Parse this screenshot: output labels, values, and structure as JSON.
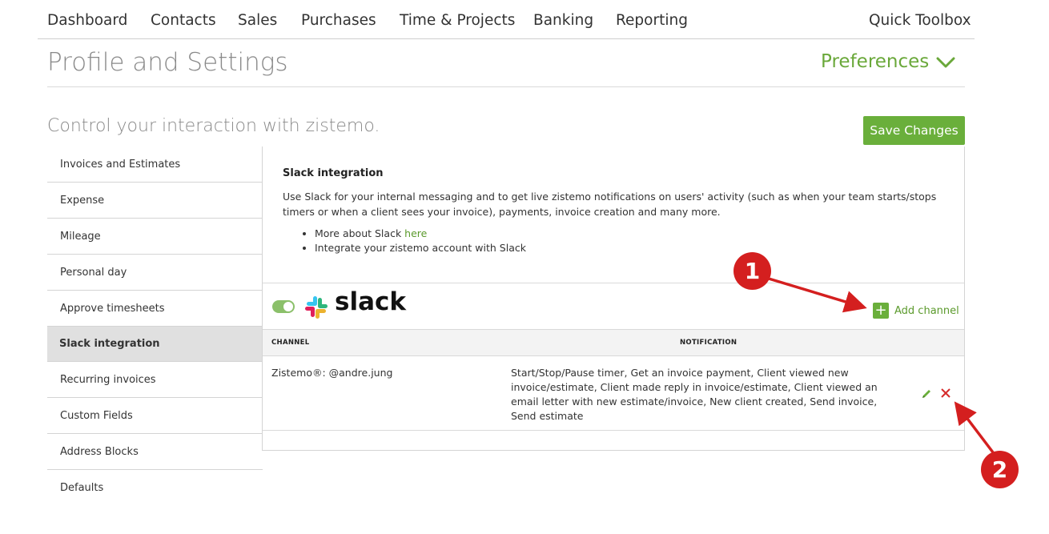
{
  "nav": {
    "items": [
      "Dashboard",
      "Contacts",
      "Sales",
      "Purchases",
      "Time & Projects",
      "Banking",
      "Reporting"
    ],
    "quick_toolbox": "Quick Toolbox"
  },
  "header": {
    "title": "Profile and Settings",
    "preferences": "Preferences",
    "preferences_icon": "chevron-down-icon"
  },
  "subheader": {
    "text": "Control your interaction with zistemo.",
    "save_label": "Save Changes"
  },
  "sidebar": {
    "items": [
      {
        "label": "Invoices and Estimates",
        "active": false
      },
      {
        "label": "Expense",
        "active": false
      },
      {
        "label": "Mileage",
        "active": false
      },
      {
        "label": "Personal day",
        "active": false
      },
      {
        "label": "Approve timesheets",
        "active": false
      },
      {
        "label": "Slack integration",
        "active": true
      },
      {
        "label": "Recurring invoices",
        "active": false
      },
      {
        "label": "Custom Fields",
        "active": false
      },
      {
        "label": "Address Blocks",
        "active": false
      },
      {
        "label": "Defaults",
        "active": false
      }
    ]
  },
  "slack": {
    "section_title": "Slack integration",
    "description": "Use Slack for your internal messaging and to get live zistemo notifications on users' activity (such as when your team starts/stops timers or when a client sees your invoice), payments, invoice creation and many more.",
    "bullet_1_prefix": "More about Slack ",
    "bullet_1_link": "here",
    "bullet_2": "Integrate your zistemo account with Slack",
    "toggle_on": true,
    "logo_text": "slack",
    "add_channel_label": "Add channel",
    "table": {
      "headers": {
        "channel": "CHANNEL",
        "notification": "NOTIFICATION"
      },
      "rows": [
        {
          "channel": "Zistemo®: @andre.jung",
          "notification": "Start/Stop/Pause timer, Get an invoice payment, Client viewed new invoice/estimate, Client made reply in invoice/estimate, Client viewed an email letter with new estimate/invoice, New client created, Send invoice, Send estimate"
        }
      ]
    }
  },
  "annotations": {
    "badge_1": "1",
    "badge_2": "2",
    "color": "#d41f1f"
  },
  "colors": {
    "accent_green": "#6aaf3b",
    "link_green": "#5b9a2c",
    "delete_red": "#d62b2b"
  }
}
